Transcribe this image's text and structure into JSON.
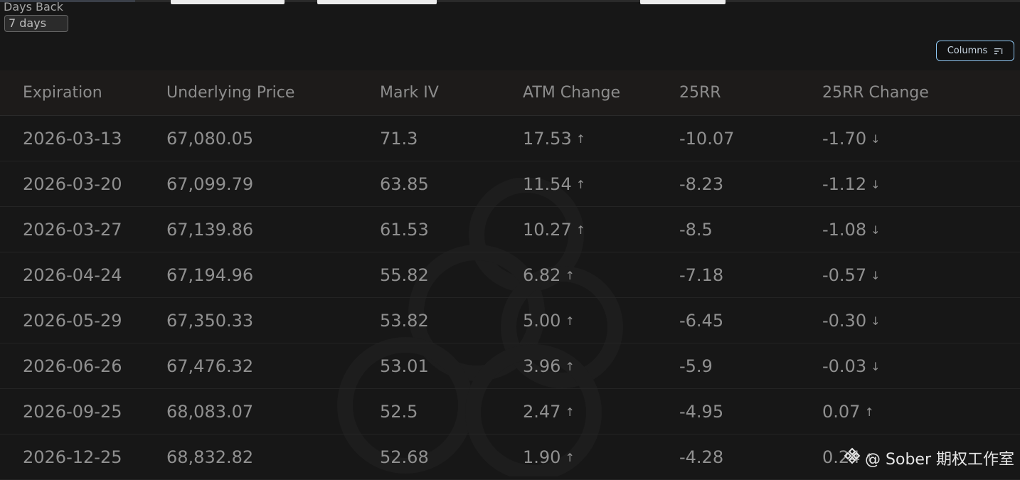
{
  "filter": {
    "days_back_label": "Days Back",
    "days_back_value": "7 days"
  },
  "toolbar": {
    "columns_label": "Columns",
    "columns_icon": "sort-lines-icon",
    "accent_color": "#8fc7f2"
  },
  "table": {
    "headers": [
      "Expiration",
      "Underlying Price",
      "Mark IV",
      "ATM Change",
      "25RR",
      "25RR Change"
    ],
    "rows": [
      {
        "expiration": "2026-03-13",
        "price": "67,080.05",
        "mark_iv": "71.3",
        "atm_change": "17.53",
        "atm_dir": "up",
        "rr25": "-10.07",
        "rr25_change": "-1.70",
        "rr25_dir": "down"
      },
      {
        "expiration": "2026-03-20",
        "price": "67,099.79",
        "mark_iv": "63.85",
        "atm_change": "11.54",
        "atm_dir": "up",
        "rr25": "-8.23",
        "rr25_change": "-1.12",
        "rr25_dir": "down"
      },
      {
        "expiration": "2026-03-27",
        "price": "67,139.86",
        "mark_iv": "61.53",
        "atm_change": "10.27",
        "atm_dir": "up",
        "rr25": "-8.5",
        "rr25_change": "-1.08",
        "rr25_dir": "down"
      },
      {
        "expiration": "2026-04-24",
        "price": "67,194.96",
        "mark_iv": "55.82",
        "atm_change": "6.82",
        "atm_dir": "up",
        "rr25": "-7.18",
        "rr25_change": "-0.57",
        "rr25_dir": "down"
      },
      {
        "expiration": "2026-05-29",
        "price": "67,350.33",
        "mark_iv": "53.82",
        "atm_change": "5.00",
        "atm_dir": "up",
        "rr25": "-6.45",
        "rr25_change": "-0.30",
        "rr25_dir": "down"
      },
      {
        "expiration": "2026-06-26",
        "price": "67,476.32",
        "mark_iv": "53.01",
        "atm_change": "3.96",
        "atm_dir": "up",
        "rr25": "-5.9",
        "rr25_change": "-0.03",
        "rr25_dir": "down"
      },
      {
        "expiration": "2026-09-25",
        "price": "68,083.07",
        "mark_iv": "52.5",
        "atm_change": "2.47",
        "atm_dir": "up",
        "rr25": "-4.95",
        "rr25_change": "0.07",
        "rr25_dir": "up"
      },
      {
        "expiration": "2026-12-25",
        "price": "68,832.82",
        "mark_iv": "52.68",
        "atm_change": "1.90",
        "atm_dir": "up",
        "rr25": "-4.28",
        "rr25_change": "0.24",
        "rr25_dir": "up"
      }
    ],
    "up_color": "#22c55e",
    "down_color": "#e8385e",
    "up_arrow": "↑",
    "down_arrow": "↓"
  },
  "credit": {
    "text": "@ Sober 期权工作室",
    "icon": "binance-logo-icon"
  }
}
